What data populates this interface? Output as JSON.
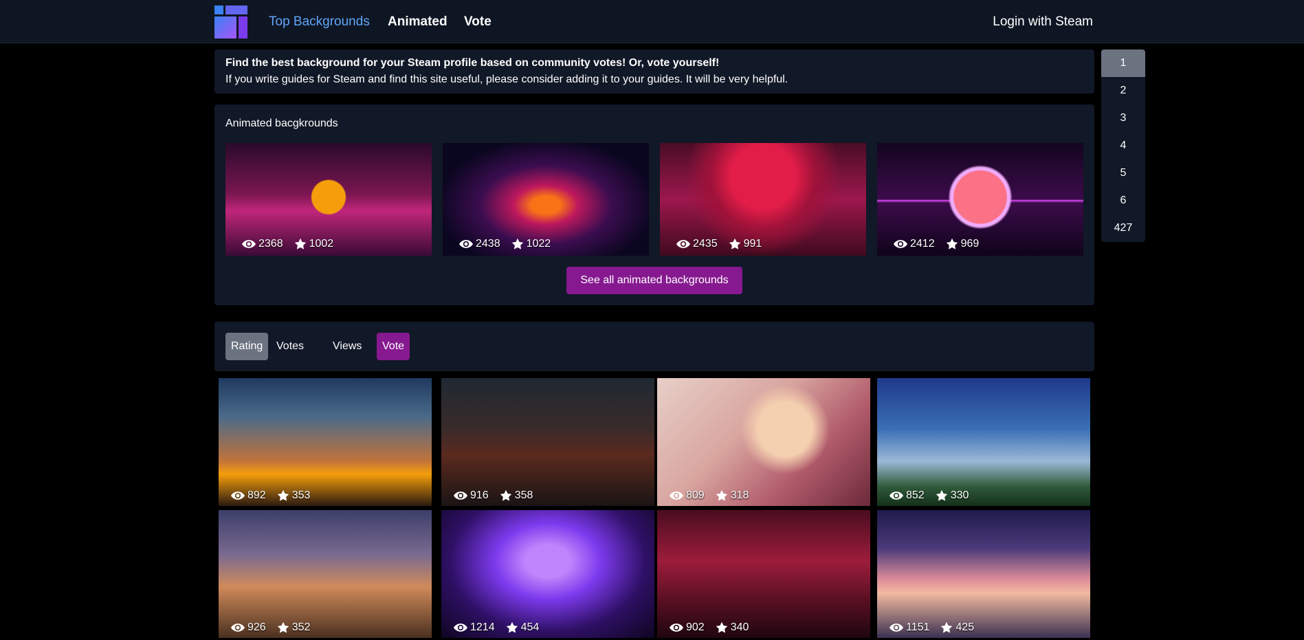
{
  "header": {
    "nav": [
      "Top Backgrounds",
      "Animated",
      "Vote"
    ],
    "login": "Login with Steam"
  },
  "info": {
    "line1": "Find the best background for your Steam profile based on community votes! Or, vote yourself!",
    "line2": "If you write guides for Steam and find this site useful, please consider adding it to your guides. It will be very helpful."
  },
  "animated": {
    "title": "Animated bacgkrounds",
    "items": [
      {
        "views": "2368",
        "stars": "1002"
      },
      {
        "views": "2438",
        "stars": "1022"
      },
      {
        "views": "2435",
        "stars": "991"
      },
      {
        "views": "2412",
        "stars": "969"
      }
    ],
    "see_all": "See all animated backgrounds"
  },
  "sort": [
    "Rating",
    "Votes",
    "Views",
    "Vote"
  ],
  "pages": [
    "1",
    "2",
    "3",
    "4",
    "5",
    "6",
    "427"
  ],
  "grid": [
    {
      "views": "892",
      "stars": "353"
    },
    {
      "views": "916",
      "stars": "358"
    },
    {
      "views": "809",
      "stars": "318"
    },
    {
      "views": "852",
      "stars": "330"
    },
    {
      "views": "926",
      "stars": "352"
    },
    {
      "views": "1214",
      "stars": "454"
    },
    {
      "views": "902",
      "stars": "340"
    },
    {
      "views": "1151",
      "stars": "425"
    }
  ],
  "colors": {
    "accent_link": "#60a5fa",
    "panel": "#111827",
    "magenta": "#86198f",
    "active_gray": "#6b7280"
  }
}
